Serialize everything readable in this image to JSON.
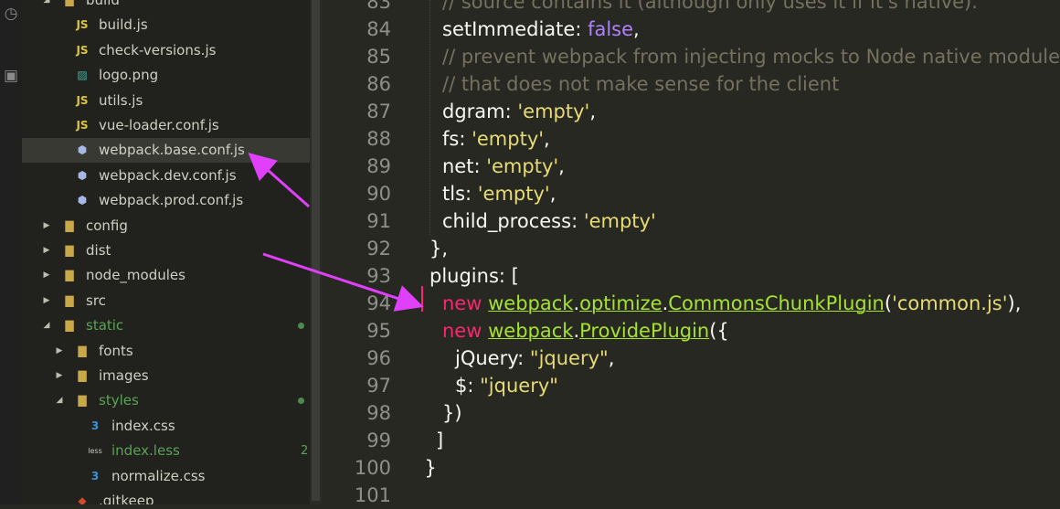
{
  "activity_bar": {
    "icons": [
      "history-icon",
      "extensions-icon"
    ]
  },
  "sidebar": {
    "items": [
      {
        "label": "build",
        "kind": "folder-open",
        "depth": 2,
        "color": "normal"
      },
      {
        "label": "build.js",
        "kind": "js",
        "depth": 3
      },
      {
        "label": "check-versions.js",
        "kind": "js",
        "depth": 3
      },
      {
        "label": "logo.png",
        "kind": "image",
        "depth": 3
      },
      {
        "label": "utils.js",
        "kind": "js",
        "depth": 3
      },
      {
        "label": "vue-loader.conf.js",
        "kind": "js",
        "depth": 3
      },
      {
        "label": "webpack.base.conf.js",
        "kind": "webpack",
        "depth": 3,
        "selected": true
      },
      {
        "label": "webpack.dev.conf.js",
        "kind": "webpack",
        "depth": 3
      },
      {
        "label": "webpack.prod.conf.js",
        "kind": "webpack",
        "depth": 3
      },
      {
        "label": "config",
        "kind": "folder",
        "depth": 2
      },
      {
        "label": "dist",
        "kind": "folder",
        "depth": 2
      },
      {
        "label": "node_modules",
        "kind": "folder",
        "depth": 2
      },
      {
        "label": "src",
        "kind": "folder",
        "depth": 2
      },
      {
        "label": "static",
        "kind": "folder-open",
        "depth": 2,
        "modified": true
      },
      {
        "label": "fonts",
        "kind": "folder",
        "depth": 3
      },
      {
        "label": "images",
        "kind": "folder",
        "depth": 3
      },
      {
        "label": "styles",
        "kind": "folder-open",
        "depth": 3,
        "modified": true
      },
      {
        "label": "index.css",
        "kind": "css",
        "depth": 4
      },
      {
        "label": "index.less",
        "kind": "less",
        "depth": 4,
        "modified": true,
        "badge": "2"
      },
      {
        "label": "normalize.css",
        "kind": "css",
        "depth": 4
      },
      {
        "label": ".gitkeep",
        "kind": "git",
        "depth": 3
      }
    ]
  },
  "editor": {
    "line_numbers": [
      "83",
      "84",
      "85",
      "86",
      "87",
      "88",
      "89",
      "90",
      "91",
      "92",
      "93",
      "94",
      "95",
      "96",
      "97",
      "98",
      "99",
      "100",
      "101"
    ],
    "lines": [
      [
        {
          "t": "// source contains it (although only uses it if it's native).",
          "c": "com",
          "i": 1
        }
      ],
      [
        {
          "t": "setImmediate",
          "c": "key",
          "i": 1
        },
        {
          "t": ": ",
          "c": "pun"
        },
        {
          "t": "false",
          "c": "bool"
        },
        {
          "t": ",",
          "c": "pun"
        }
      ],
      [
        {
          "t": "// prevent webpack from injecting mocks to Node native modules",
          "c": "com",
          "i": 1
        }
      ],
      [
        {
          "t": "// that does not make sense for the client",
          "c": "com",
          "i": 1
        }
      ],
      [
        {
          "t": "dgram",
          "c": "key",
          "i": 1
        },
        {
          "t": ": ",
          "c": "pun"
        },
        {
          "t": "'empty'",
          "c": "str"
        },
        {
          "t": ",",
          "c": "pun"
        }
      ],
      [
        {
          "t": "fs",
          "c": "key",
          "i": 1
        },
        {
          "t": ": ",
          "c": "pun"
        },
        {
          "t": "'empty'",
          "c": "str"
        },
        {
          "t": ",",
          "c": "pun"
        }
      ],
      [
        {
          "t": "net",
          "c": "key",
          "i": 1
        },
        {
          "t": ": ",
          "c": "pun"
        },
        {
          "t": "'empty'",
          "c": "str"
        },
        {
          "t": ",",
          "c": "pun"
        }
      ],
      [
        {
          "t": "tls",
          "c": "key",
          "i": 1
        },
        {
          "t": ": ",
          "c": "pun"
        },
        {
          "t": "'empty'",
          "c": "str"
        },
        {
          "t": ",",
          "c": "pun"
        }
      ],
      [
        {
          "t": "child_process",
          "c": "key",
          "i": 1
        },
        {
          "t": ": ",
          "c": "pun"
        },
        {
          "t": "'empty'",
          "c": "str"
        }
      ],
      [
        {
          "t": "},",
          "c": "pun",
          "i": 0
        }
      ],
      [
        {
          "t": "plugins",
          "c": "key",
          "i": 0
        },
        {
          "t": ": [",
          "c": "pun"
        }
      ],
      [
        {
          "t": "new ",
          "c": "new",
          "i": 1
        },
        {
          "t": "webpack",
          "c": "fn"
        },
        {
          "t": ".",
          "c": "pun"
        },
        {
          "t": "optimize",
          "c": "fn"
        },
        {
          "t": ".",
          "c": "pun"
        },
        {
          "t": "CommonsChunkPlugin",
          "c": "fn"
        },
        {
          "t": "(",
          "c": "pun"
        },
        {
          "t": "'common.js'",
          "c": "str"
        },
        {
          "t": "),",
          "c": "pun"
        }
      ],
      [
        {
          "t": "new ",
          "c": "new",
          "i": 1
        },
        {
          "t": "webpack",
          "c": "fn"
        },
        {
          "t": ".",
          "c": "pun"
        },
        {
          "t": "ProvidePlugin",
          "c": "fn"
        },
        {
          "t": "({",
          "c": "pun"
        }
      ],
      [
        {
          "t": "jQuery",
          "c": "key",
          "i": 2
        },
        {
          "t": ": ",
          "c": "pun"
        },
        {
          "t": "\"jquery\"",
          "c": "str"
        },
        {
          "t": ",",
          "c": "pun"
        }
      ],
      [
        {
          "t": "$",
          "c": "key",
          "i": 2
        },
        {
          "t": ": ",
          "c": "pun"
        },
        {
          "t": "\"jquery\"",
          "c": "str"
        }
      ],
      [
        {
          "t": "})",
          "c": "pun",
          "i": 1
        }
      ],
      [
        {
          "t": "]",
          "c": "pun",
          "i": 0.5
        }
      ],
      [
        {
          "t": "}",
          "c": "pun",
          "i": -0.4
        }
      ],
      [
        {
          "t": "",
          "c": "pun",
          "i": 0
        }
      ]
    ]
  },
  "colors": {
    "annotation_arrow": "#e040fb",
    "cursor": "#f92672"
  }
}
